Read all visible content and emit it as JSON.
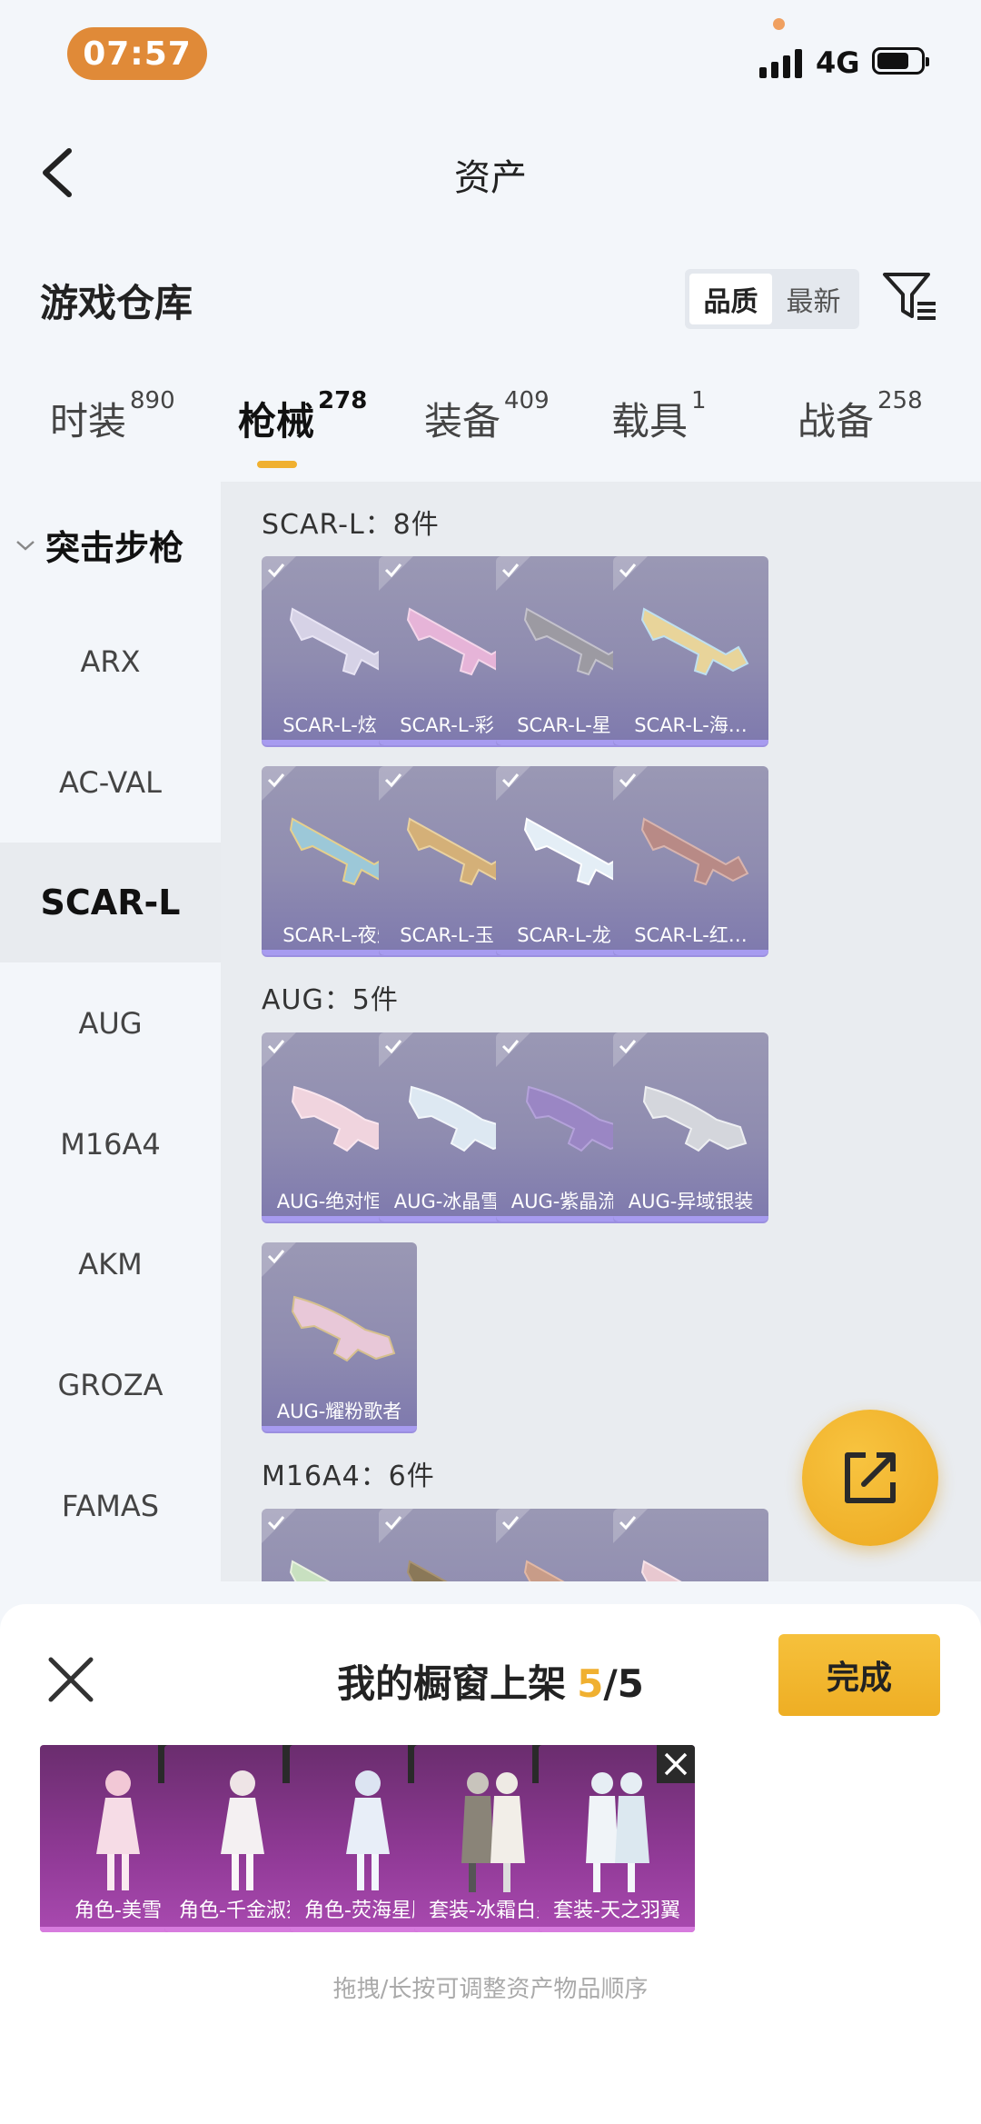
{
  "status": {
    "time": "07:57",
    "network": "4G"
  },
  "header": {
    "title": "资产"
  },
  "section": {
    "title": "游戏仓库",
    "sort_options": [
      "品质",
      "最新"
    ]
  },
  "tabs": [
    {
      "label": "时装",
      "count": "890"
    },
    {
      "label": "枪械",
      "count": "278"
    },
    {
      "label": "装备",
      "count": "409"
    },
    {
      "label": "载具",
      "count": "1"
    },
    {
      "label": "战备",
      "count": "258"
    }
  ],
  "sidebar": {
    "group": "突击步枪",
    "items": [
      "ARX",
      "AC-VAL",
      "SCAR-L",
      "AUG",
      "M16A4",
      "AKM",
      "GROZA",
      "FAMAS"
    ]
  },
  "groups": [
    {
      "title": "SCAR-L：8件",
      "items": [
        "SCAR-L-炫…",
        "SCAR-L-彩…",
        "SCAR-L-星…",
        "SCAR-L-海…",
        "SCAR-L-夜灯",
        "SCAR-L-玉…",
        "SCAR-L-龙…",
        "SCAR-L-红…"
      ]
    },
    {
      "title": "AUG：5件",
      "items": [
        "AUG-绝对恒星",
        "AUG-冰晶雪宝",
        "AUG-紫晶流影",
        "AUG-异域银装",
        "AUG-耀粉歌者"
      ]
    },
    {
      "title": "M16A4：6件",
      "items": [
        "",
        "",
        "",
        ""
      ]
    }
  ],
  "sheet": {
    "title": "我的橱窗上架",
    "count_current": "5",
    "count_total": "/5",
    "done_label": "完成",
    "items": [
      "角色-美雪",
      "角色-千金淑猫",
      "角色-荧海星豚",
      "套装-冰霜白皇",
      "套装-天之羽翼"
    ],
    "hint": "拖拽/长按可调整资产物品顺序"
  },
  "colors": {
    "accent": "#F0B030",
    "card_purple": "#8F8CB0",
    "shelf_magenta": "#913A97"
  }
}
